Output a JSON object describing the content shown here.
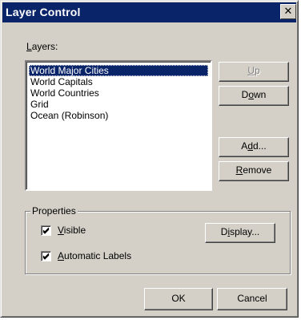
{
  "window": {
    "title": "Layer Control",
    "close_glyph": "✕"
  },
  "layers": {
    "label_pre": "",
    "label_mnemonic": "L",
    "label_post": "ayers:",
    "items": [
      "World Major Cities",
      "World Capitals",
      "World Countries",
      "Grid",
      "Ocean (Robinson)"
    ],
    "selected_index": 0
  },
  "buttons": {
    "up": {
      "pre": "",
      "mn": "U",
      "post": "p",
      "enabled": false
    },
    "down": {
      "pre": "D",
      "mn": "o",
      "post": "wn",
      "enabled": true
    },
    "add": {
      "pre": "A",
      "mn": "d",
      "post": "d...",
      "enabled": true
    },
    "remove": {
      "pre": "",
      "mn": "R",
      "post": "emove",
      "enabled": true
    },
    "display": {
      "pre": "D",
      "mn": "i",
      "post": "splay...",
      "enabled": true
    },
    "ok": {
      "label": "OK"
    },
    "cancel": {
      "label": "Cancel"
    }
  },
  "properties": {
    "title": "Properties",
    "visible": {
      "pre": "",
      "mn": "V",
      "post": "isible",
      "checked": true
    },
    "auto_labels": {
      "pre": "",
      "mn": "A",
      "post": "utomatic Labels",
      "checked": true
    }
  },
  "colors": {
    "face": "#d4d0c8",
    "selection": "#0a246a",
    "titlebar": "#0a246a"
  }
}
